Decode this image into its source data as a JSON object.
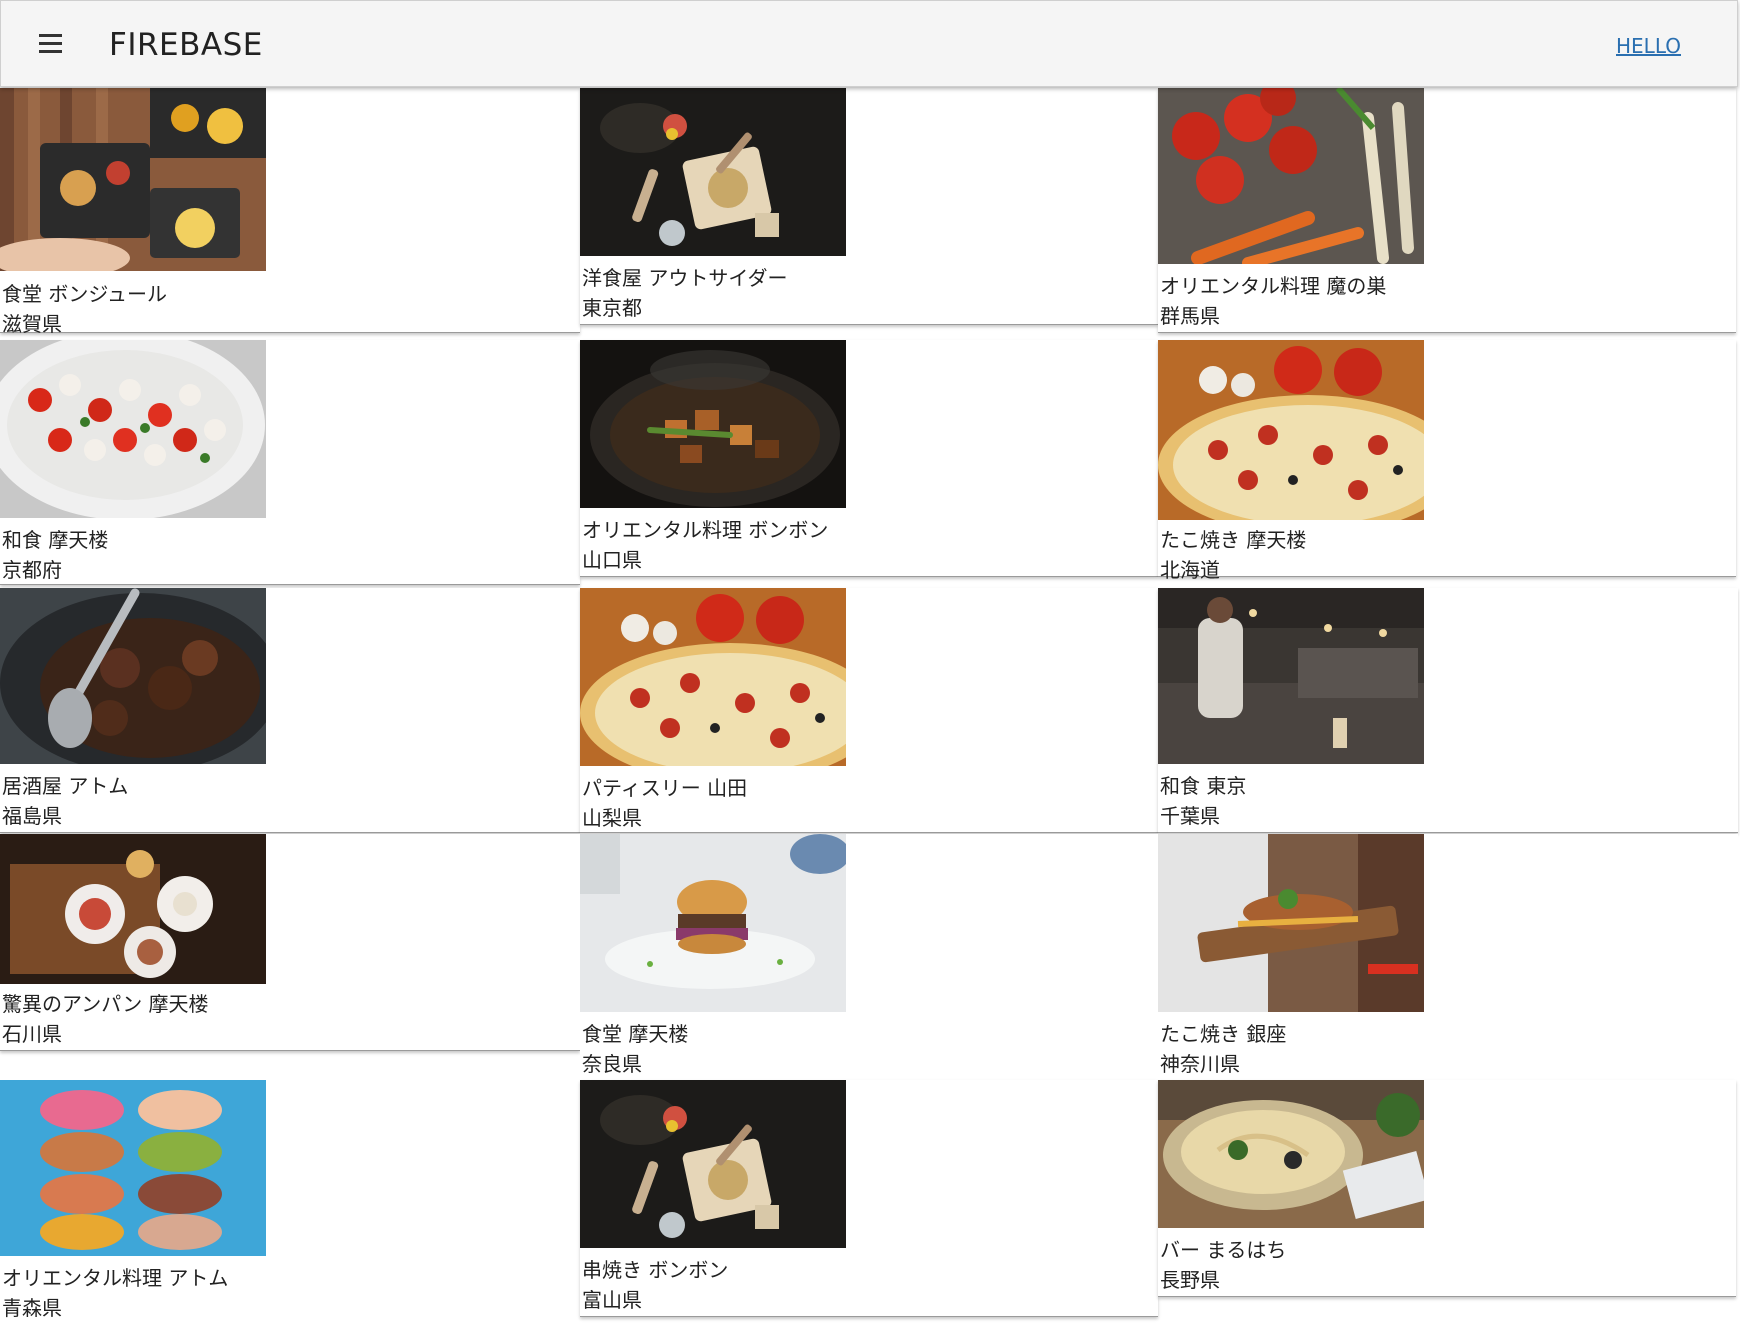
{
  "appbar": {
    "title": "FIREBASE",
    "menu_icon": "hamburger-menu-icon",
    "hello_link": "HELLO",
    "link_color": "#2a6fb0",
    "background": "#f5f5f5"
  },
  "restaurants": [
    {
      "name": "食堂 ボンジュール",
      "prefecture": "滋賀県",
      "photo": "table-spread-photo"
    },
    {
      "name": "洋食屋 アウトサイダー",
      "prefecture": "東京都",
      "photo": "dark-plate-photo"
    },
    {
      "name": "オリエンタル料理 魔の巣",
      "prefecture": "群馬県",
      "photo": "vegetables-photo"
    },
    {
      "name": "和食 摩天楼",
      "prefecture": "京都府",
      "photo": "caprese-salad-photo"
    },
    {
      "name": "オリエンタル料理 ボンボン",
      "prefecture": "山口県",
      "photo": "wok-stirfry-photo"
    },
    {
      "name": "たこ焼き 摩天楼",
      "prefecture": "北海道",
      "photo": "pizza-photo"
    },
    {
      "name": "居酒屋 アトム",
      "prefecture": "福島県",
      "photo": "braised-meat-photo"
    },
    {
      "name": "パティスリー 山田",
      "prefecture": "山梨県",
      "photo": "pizza-photo"
    },
    {
      "name": "和食 東京",
      "prefecture": "千葉県",
      "photo": "restaurant-kitchen-photo"
    },
    {
      "name": "驚異のアンパン 摩天楼",
      "prefecture": "石川県",
      "photo": "wood-table-plates-photo"
    },
    {
      "name": "食堂 摩天楼",
      "prefecture": "奈良県",
      "photo": "burger-photo"
    },
    {
      "name": "たこ焼き 銀座",
      "prefecture": "神奈川県",
      "photo": "waiter-platter-photo"
    },
    {
      "name": "オリエンタル料理 アトム",
      "prefecture": "青森県",
      "photo": "macarons-photo"
    },
    {
      "name": "串焼き ボンボン",
      "prefecture": "富山県",
      "photo": "dark-plate-photo"
    },
    {
      "name": "バー まるはち",
      "prefecture": "長野県",
      "photo": "pasta-bowl-photo"
    }
  ]
}
